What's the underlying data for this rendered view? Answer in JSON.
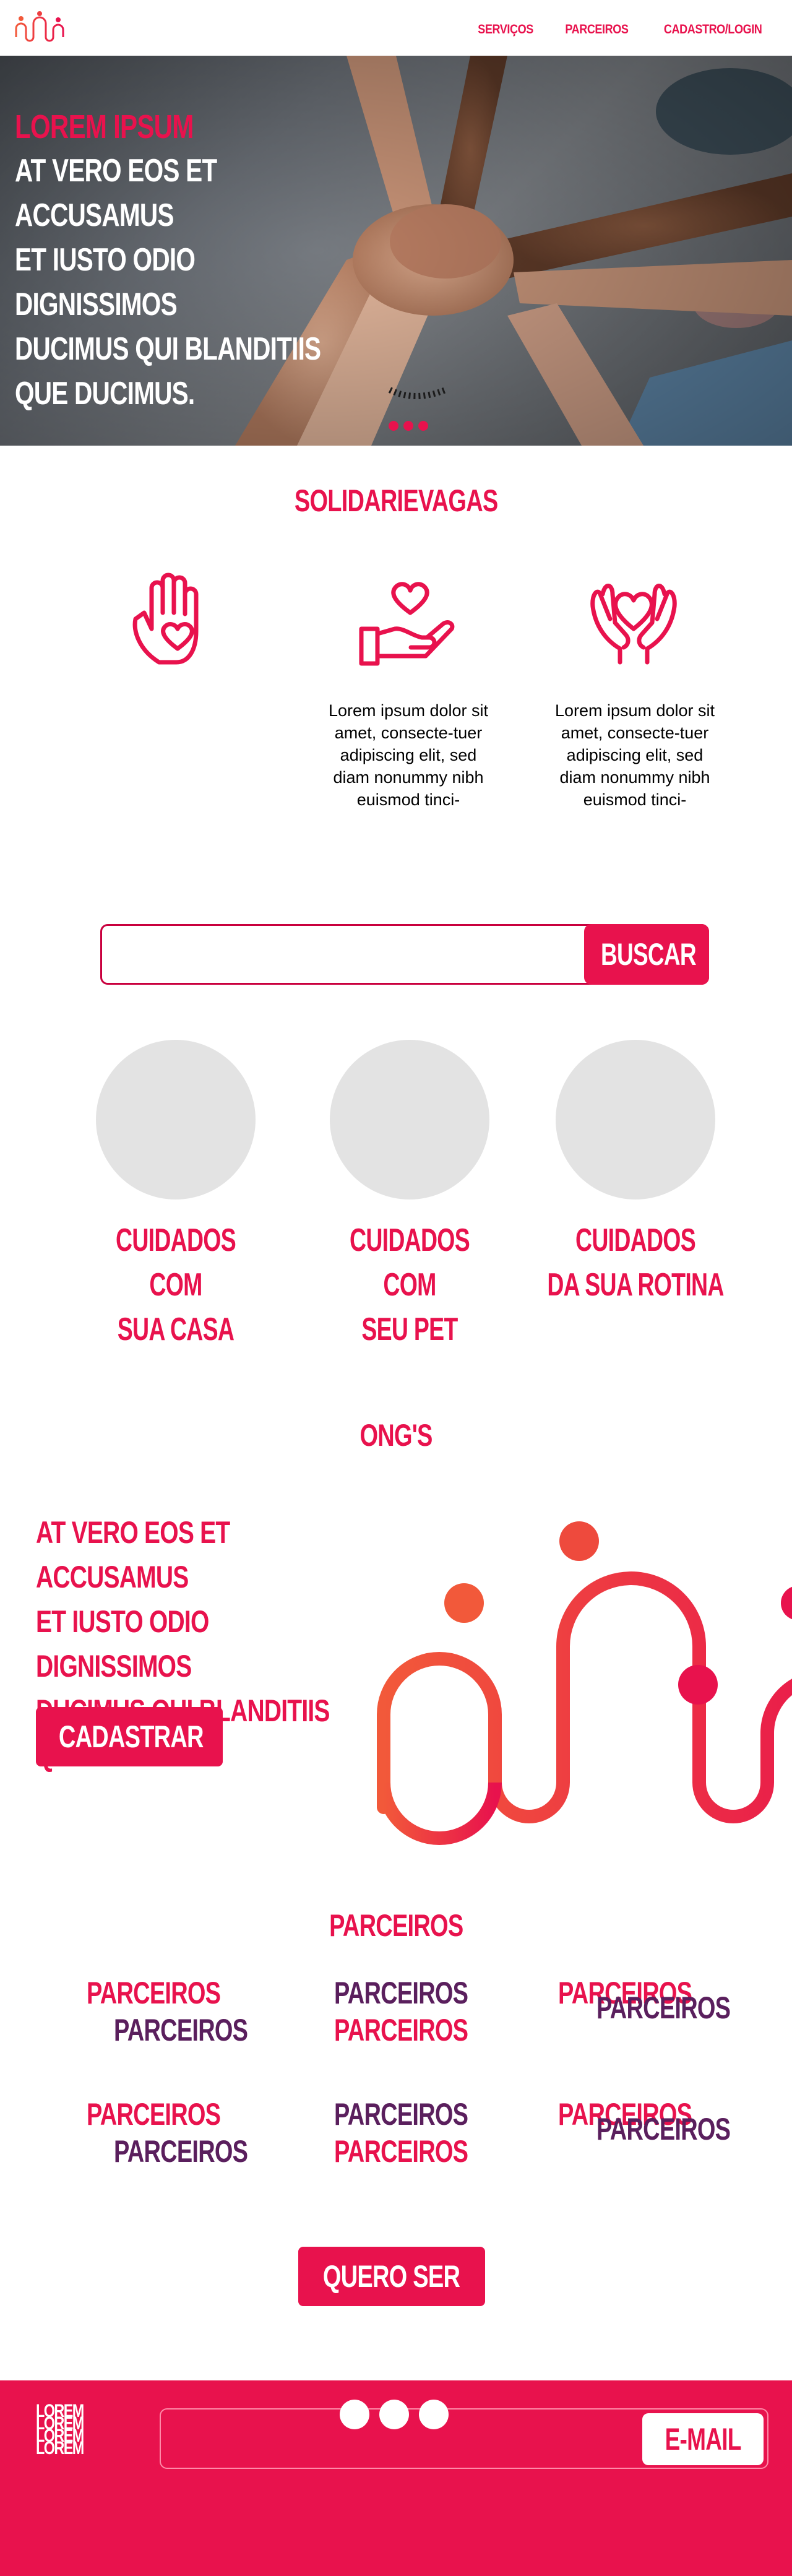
{
  "header": {
    "nav": [
      "SERVIÇOS",
      "PARCEIROS",
      "CADASTRO/LOGIN"
    ]
  },
  "hero": {
    "eyebrow": "LOREM IPSUM",
    "lines": [
      "AT VERO EOS ET ACCUSAMUS",
      "ET IUSTO ODIO DIGNISSIMOS",
      "DUCIMUS QUI BLANDITIIS",
      "QUE DUCIMUS."
    ],
    "slides": 3
  },
  "features": {
    "title": "SOLIDARIEVAGAS",
    "items": [
      {
        "icon": "hand-heart-icon",
        "text": ""
      },
      {
        "icon": "giving-hand-heart-icon",
        "text": "Lorem ipsum dolor sit amet, consecte-tuer adipiscing elit, sed diam nonummy nibh euismod tinci-"
      },
      {
        "icon": "hands-holding-heart-icon",
        "text": "Lorem ipsum dolor sit amet, consecte-tuer adipiscing elit, sed diam nonummy nibh euismod tinci-"
      }
    ]
  },
  "search": {
    "placeholder": "",
    "button": "BUSCAR"
  },
  "categories": [
    {
      "line1": "CUIDADOS COM",
      "line2": "SUA CASA"
    },
    {
      "line1": "CUIDADOS COM",
      "line2": "SEU PET"
    },
    {
      "line1": "CUIDADOS",
      "line2": "DA SUA ROTINA"
    }
  ],
  "ongs": {
    "title": "ONG'S",
    "lines": [
      "AT VERO EOS ET ACCUSAMUS",
      "ET IUSTO ODIO DIGNISSIMOS",
      "DUCIMUS QUI BLANDITIIS",
      "QUE DUCIMUS."
    ],
    "button": "CADASTRAR"
  },
  "partners": {
    "title": "PARCEIROS",
    "word": "PARCEIROS",
    "cta": "QUERO SER"
  },
  "footer": {
    "logo_word": "LOREM",
    "email_placeholder": "",
    "email_button": "E-MAIL"
  },
  "colors": {
    "accent": "#e8124d",
    "purple": "#5a1f5d",
    "gradient_start": "#f2593a",
    "gradient_end": "#e8124d"
  }
}
